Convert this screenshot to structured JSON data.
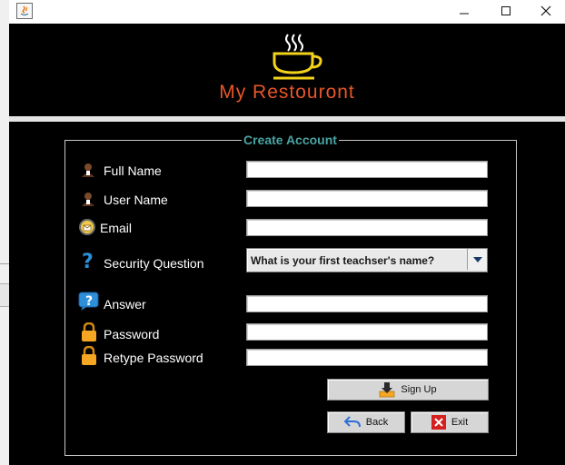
{
  "window": {
    "app_icon": "java-icon",
    "controls": [
      "minimize-icon",
      "maximize-icon",
      "close-icon"
    ]
  },
  "header": {
    "app_name": "My Restouront",
    "logo_icon": "coffee-cup-icon",
    "accent_color": "#e8562a",
    "logo_color": "#f2d21b"
  },
  "form": {
    "title": "Create Account",
    "title_color": "#4aa3a3",
    "fields": [
      {
        "label": "Full Name",
        "icon": "user-icon",
        "value": ""
      },
      {
        "label": "User Name",
        "icon": "user-icon",
        "value": ""
      },
      {
        "label": "Email",
        "icon": "email-icon",
        "value": ""
      },
      {
        "label": "Security Question",
        "icon": "question-mark-icon"
      },
      {
        "label": "Answer",
        "icon": "help-bubble-icon",
        "value": ""
      },
      {
        "label": "Password",
        "icon": "lock-icon",
        "value": ""
      },
      {
        "label": "Retype Password",
        "icon": "lock-icon",
        "value": ""
      }
    ],
    "security_question": {
      "selected": "What is your first teachser's name?"
    },
    "buttons": {
      "signup": {
        "label": "Sign Up",
        "icon": "download-tray-icon"
      },
      "back": {
        "label": "Back",
        "icon": "undo-arrow-icon"
      },
      "exit": {
        "label": "Exit",
        "icon": "red-x-icon"
      }
    }
  }
}
